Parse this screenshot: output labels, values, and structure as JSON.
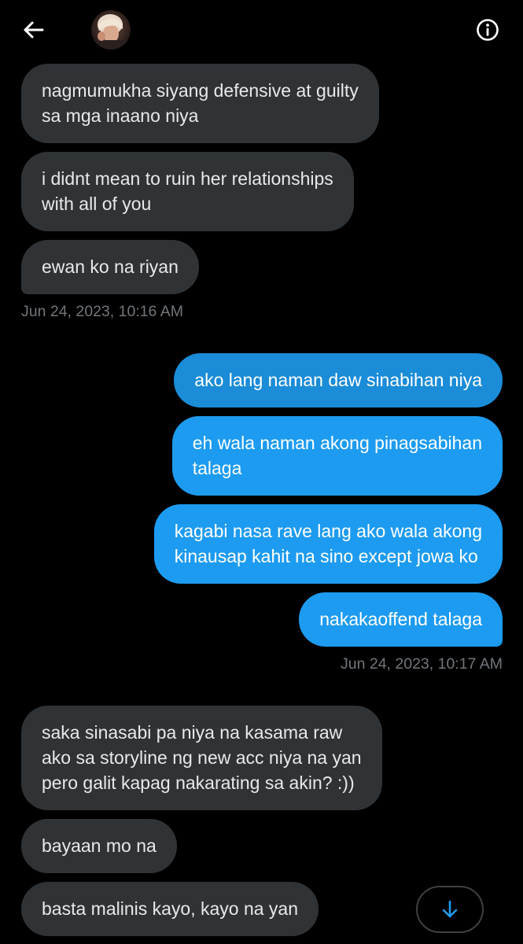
{
  "header": {
    "back_icon": "arrow-left-icon",
    "avatar_icon": "user-avatar",
    "info_icon": "info-circle-icon"
  },
  "colors": {
    "background": "#000000",
    "received_bubble": "#2f3336",
    "sent_bubble": "#1d9bf0",
    "timestamp": "#71767b",
    "accent": "#1d9bf0"
  },
  "messages": [
    {
      "direction": "received",
      "lines": [
        "nagmumukha siyang defensive at guilty",
        "sa mga inaano niya"
      ]
    },
    {
      "direction": "received",
      "lines": [
        "i didnt mean to ruin her relationships",
        "with all of you"
      ]
    },
    {
      "direction": "received",
      "lines": [
        "ewan ko na riyan"
      ]
    },
    {
      "direction": "sent",
      "lines": [
        "ako lang naman daw sinabihan niya"
      ]
    },
    {
      "direction": "sent",
      "lines": [
        "eh wala naman akong pinagsabihan",
        "talaga"
      ]
    },
    {
      "direction": "sent",
      "lines": [
        "kagabi nasa rave lang ako wala akong",
        "kinausap kahit na sino except jowa ko"
      ]
    },
    {
      "direction": "sent",
      "lines": [
        "nakakaoffend talaga"
      ]
    },
    {
      "direction": "received",
      "lines": [
        "saka sinasabi pa niya na kasama raw",
        "ako sa storyline ng new acc niya na yan",
        "pero galit kapag nakarating sa akin? :))"
      ]
    },
    {
      "direction": "received",
      "lines": [
        "bayaan mo na"
      ]
    },
    {
      "direction": "received",
      "lines": [
        "basta malinis kayo, kayo na yan"
      ]
    }
  ],
  "timestamps": [
    "Jun 24, 2023, 10:16 AM",
    "Jun 24, 2023, 10:17 AM"
  ],
  "scroll_down_icon": "arrow-down-icon"
}
